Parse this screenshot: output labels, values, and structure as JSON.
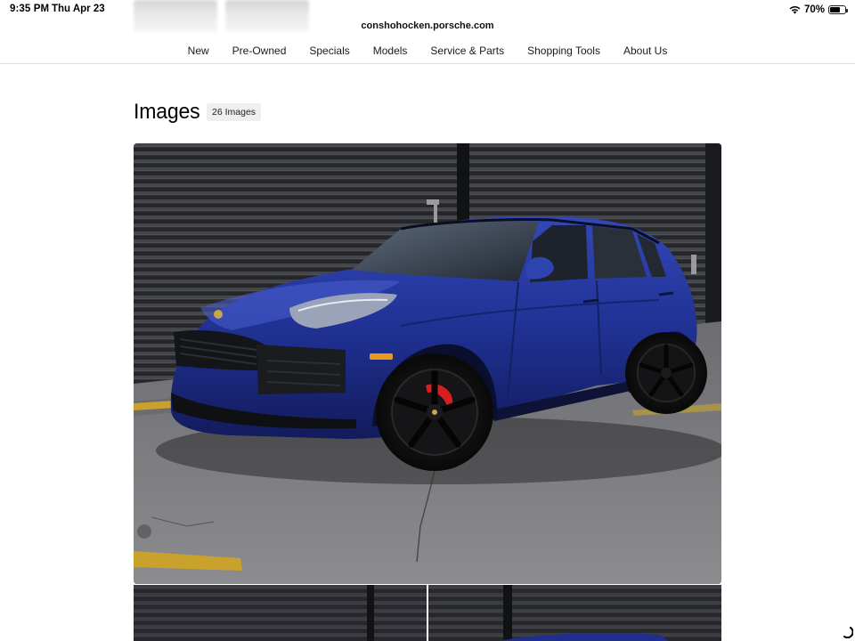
{
  "status_bar": {
    "time": "9:35 PM",
    "date": "Thu Apr 23",
    "battery_percent": "70%",
    "battery_level": 0.7,
    "icons": [
      "wifi-icon",
      "battery-icon"
    ]
  },
  "browser": {
    "address": "conshohocken.porsche.com"
  },
  "nav": {
    "items": [
      {
        "label": "New"
      },
      {
        "label": "Pre-Owned"
      },
      {
        "label": "Specials"
      },
      {
        "label": "Models"
      },
      {
        "label": "Service & Parts"
      },
      {
        "label": "Shopping Tools"
      },
      {
        "label": "About Us"
      }
    ]
  },
  "gallery": {
    "title": "Images",
    "count_badge": "26 Images"
  },
  "colors": {
    "car_body": "#1e2f8f",
    "brake_caliper": "#d42020",
    "wall": "#2a2b2f",
    "pavement": "#7f7f82",
    "parking_line": "#c9a22e"
  }
}
